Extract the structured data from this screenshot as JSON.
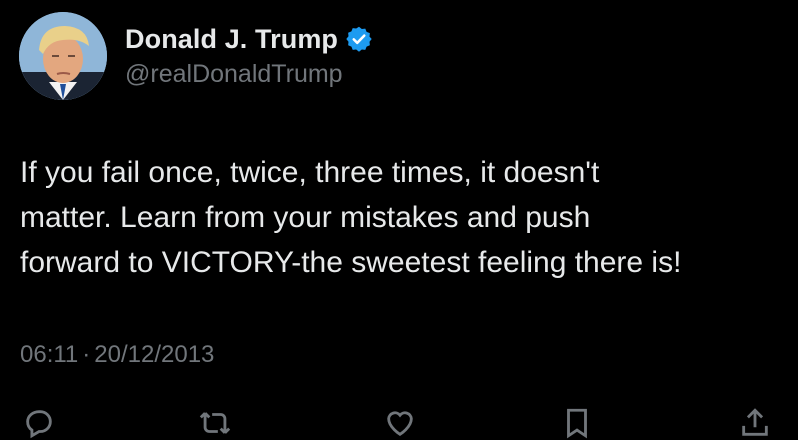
{
  "author": {
    "display_name": "Donald J. Trump",
    "handle": "@realDonaldTrump",
    "verified": true,
    "avatar_icon": "profile-photo"
  },
  "tweet": {
    "text": "If you fail once, twice, three times, it doesn't\nmatter. Learn from your mistakes and push\nforward to VICTORY-the sweetest feeling there is!",
    "time": "06:11",
    "separator": "·",
    "date": "20/12/2013"
  },
  "actions": [
    {
      "icon": "reply-icon"
    },
    {
      "icon": "retweet-icon"
    },
    {
      "icon": "like-icon"
    },
    {
      "icon": "bookmark-icon"
    }
  ],
  "colors": {
    "background": "#000000",
    "text": "#e7e9ea",
    "secondary": "#71767b",
    "verified": "#1d9bf0"
  }
}
